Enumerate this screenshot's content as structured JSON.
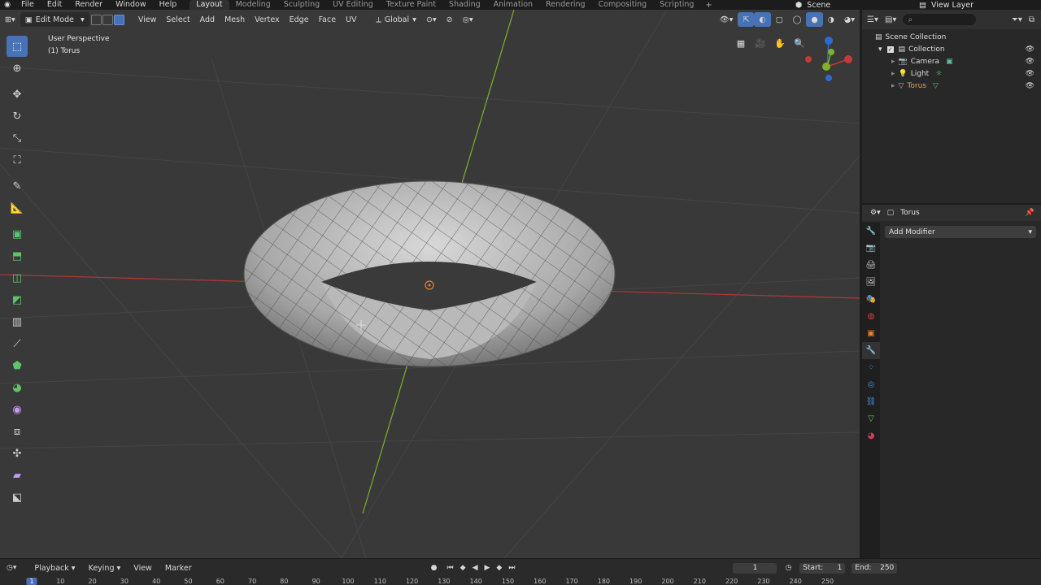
{
  "menubar": {
    "menus": [
      "File",
      "Edit",
      "Render",
      "Window",
      "Help"
    ],
    "workspaces": [
      "Layout",
      "Modeling",
      "Sculpting",
      "UV Editing",
      "Texture Paint",
      "Shading",
      "Animation",
      "Rendering",
      "Compositing",
      "Scripting"
    ],
    "active_workspace": "Layout",
    "scene": "Scene",
    "view_layer": "View Layer"
  },
  "viewport_header": {
    "mode": "Edit Mode",
    "menus": [
      "View",
      "Select",
      "Add",
      "Mesh",
      "Vertex",
      "Edge",
      "Face",
      "UV"
    ],
    "orientation": "Global"
  },
  "viewport_overlay": {
    "view_name": "User Perspective",
    "object_label": "(1) Torus"
  },
  "gizmo": {
    "z": "Z",
    "x": "X",
    "y": "Y"
  },
  "outliner": {
    "root": "Scene Collection",
    "collection": "Collection",
    "items": [
      {
        "name": "Camera",
        "icon": "camera-icon",
        "color": "#e0e0e0"
      },
      {
        "name": "Light",
        "icon": "light-icon",
        "color": "#e0e0e0"
      },
      {
        "name": "Torus",
        "icon": "mesh-icon",
        "color": "#f0a050"
      }
    ]
  },
  "properties": {
    "object_name": "Torus",
    "add_modifier": "Add Modifier"
  },
  "timeline": {
    "menus": [
      "Playback",
      "Keying",
      "View",
      "Marker"
    ],
    "current_frame": "1",
    "start_label": "Start:",
    "start": "1",
    "end_label": "End:",
    "end": "250",
    "ruler": [
      "1",
      "10",
      "20",
      "30",
      "40",
      "50",
      "60",
      "70",
      "80",
      "90",
      "100",
      "110",
      "120",
      "130",
      "140",
      "150",
      "160",
      "170",
      "180",
      "190",
      "200",
      "210",
      "220",
      "230",
      "240",
      "250"
    ]
  },
  "colors": {
    "accent": "#4772b3",
    "x_axis": "#c23a3a",
    "y_axis": "#7fb12a",
    "active_object": "#f0a050"
  }
}
